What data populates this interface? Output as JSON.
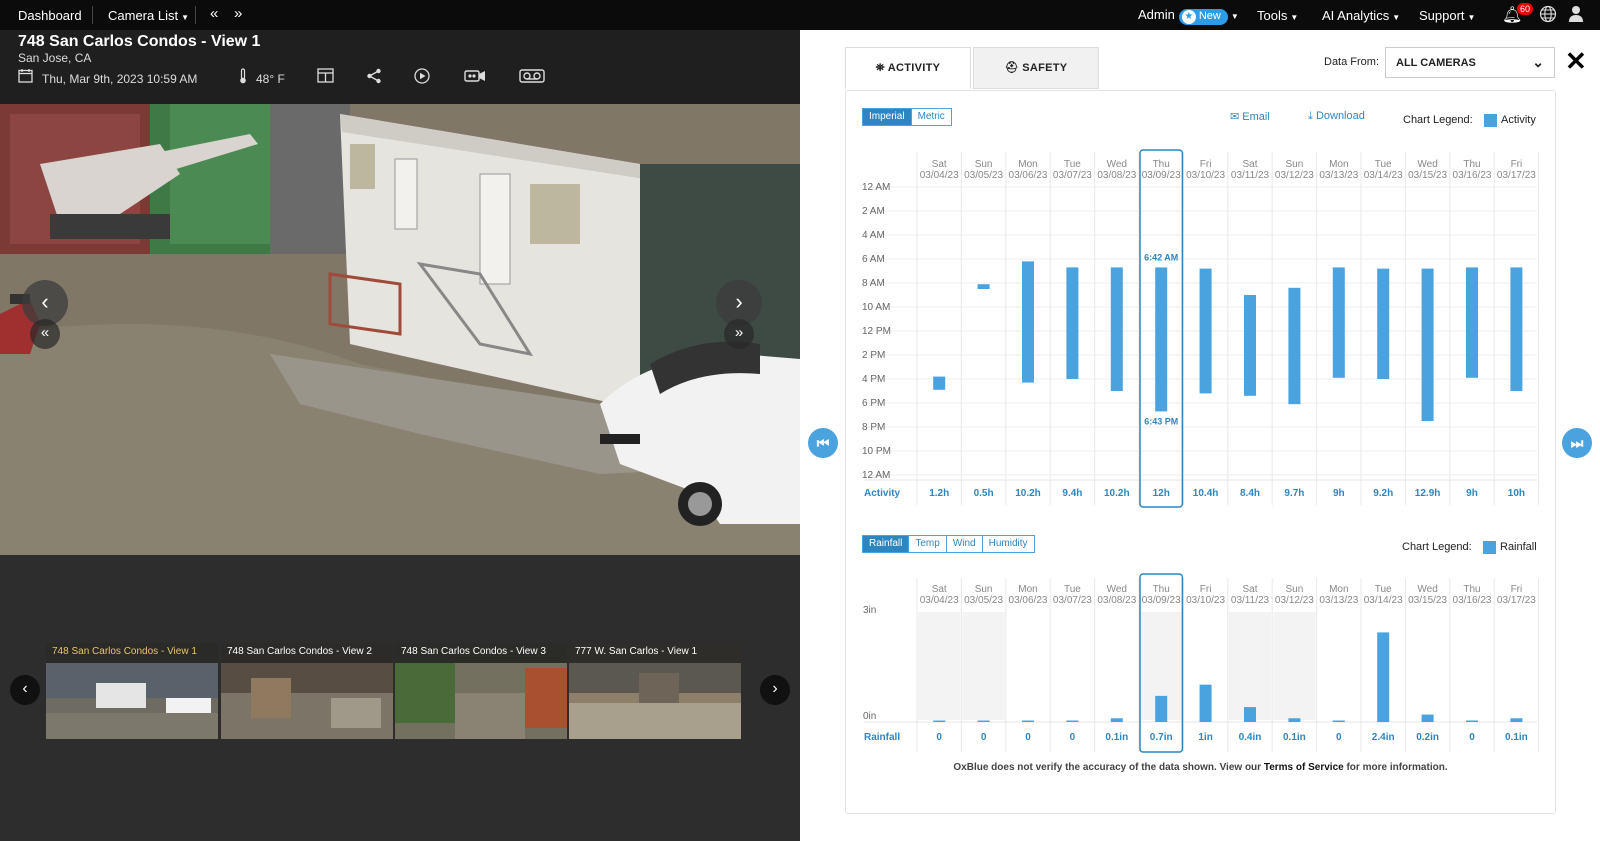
{
  "topbar": {
    "dashboard": "Dashboard",
    "camera_list": "Camera List",
    "admin": "Admin",
    "new_badge": "New",
    "tools": "Tools",
    "ai_analytics": "AI Analytics",
    "support": "Support",
    "notification_count": "60"
  },
  "camera": {
    "title": "748 San Carlos Condos - View 1",
    "location": "San Jose, CA",
    "datetime": "Thu, Mar 9th, 2023 10:59 AM",
    "temperature": "48° F"
  },
  "thumbnails": [
    {
      "label": "748 San Carlos Condos - View 1",
      "active": true
    },
    {
      "label": "748 San Carlos Condos - View 2",
      "active": false
    },
    {
      "label": "748 San Carlos Condos - View 3",
      "active": false
    },
    {
      "label": "777 W. San Carlos - View 1",
      "active": false
    }
  ],
  "tabs": {
    "activity": "ACTIVITY",
    "safety": "SAFETY"
  },
  "data_from": {
    "label": "Data From:",
    "value": "ALL CAMERAS"
  },
  "units": {
    "imperial": "Imperial",
    "metric": "Metric"
  },
  "actions": {
    "email": "Email",
    "download": "Download"
  },
  "legend": {
    "label": "Chart Legend:",
    "activity": "Activity",
    "rainfall": "Rainfall"
  },
  "weather_tabs": {
    "rainfall": "Rainfall",
    "temp": "Temp",
    "wind": "Wind",
    "humidity": "Humidity"
  },
  "disclaimer": {
    "prefix": "OxBlue does not verify the accuracy of the data shown. View our ",
    "link": "Terms of Service",
    "suffix": " for more information."
  },
  "colors": {
    "accent": "#4aa3df",
    "accent_dark": "#2e86c1",
    "highlight_border": "#2e86c1"
  },
  "chart_data": [
    {
      "type": "bar",
      "name": "activity",
      "days": [
        {
          "dow": "Sat",
          "date": "03/04/23"
        },
        {
          "dow": "Sun",
          "date": "03/05/23"
        },
        {
          "dow": "Mon",
          "date": "03/06/23"
        },
        {
          "dow": "Tue",
          "date": "03/07/23"
        },
        {
          "dow": "Wed",
          "date": "03/08/23"
        },
        {
          "dow": "Thu",
          "date": "03/09/23"
        },
        {
          "dow": "Fri",
          "date": "03/10/23"
        },
        {
          "dow": "Sat",
          "date": "03/11/23"
        },
        {
          "dow": "Sun",
          "date": "03/12/23"
        },
        {
          "dow": "Mon",
          "date": "03/13/23"
        },
        {
          "dow": "Tue",
          "date": "03/14/23"
        },
        {
          "dow": "Wed",
          "date": "03/15/23"
        },
        {
          "dow": "Thu",
          "date": "03/16/23"
        },
        {
          "dow": "Fri",
          "date": "03/17/23"
        }
      ],
      "y_ticks": [
        "12 AM",
        "2 AM",
        "4 AM",
        "6 AM",
        "8 AM",
        "10 AM",
        "12 PM",
        "2 PM",
        "4 PM",
        "6 PM",
        "8 PM",
        "10 PM",
        "12 AM"
      ],
      "ylim_hours": [
        0,
        24
      ],
      "ranges_hours": [
        [
          15.8,
          16.9
        ],
        [
          8.1,
          8.5
        ],
        [
          6.2,
          16.3
        ],
        [
          6.7,
          16.0
        ],
        [
          6.7,
          17.0
        ],
        [
          6.7,
          18.7
        ],
        [
          6.8,
          17.2
        ],
        [
          9.0,
          17.4
        ],
        [
          8.4,
          18.1
        ],
        [
          6.7,
          15.9
        ],
        [
          6.8,
          16.0
        ],
        [
          6.8,
          19.5
        ],
        [
          6.7,
          15.9
        ],
        [
          6.7,
          17.0
        ]
      ],
      "row_label": "Activity",
      "totals": [
        "1.2h",
        "0.5h",
        "10.2h",
        "9.4h",
        "10.2h",
        "12h",
        "10.4h",
        "8.4h",
        "9.7h",
        "9h",
        "9.2h",
        "12.9h",
        "9h",
        "10h"
      ],
      "highlight_index": 5,
      "highlight_start": "6:42 AM",
      "highlight_end": "6:43 PM"
    },
    {
      "type": "bar",
      "name": "rainfall",
      "y_ticks": [
        "3in",
        "0in"
      ],
      "ylim": [
        0,
        3
      ],
      "values": [
        0.03,
        0.03,
        0.02,
        0,
        0.1,
        0.7,
        1.0,
        0.4,
        0.1,
        0,
        2.4,
        0.2,
        0,
        0.1
      ],
      "row_label": "Rainfall",
      "labels": [
        "0",
        "0",
        "0",
        "0",
        "0.1in",
        "0.7in",
        "1in",
        "0.4in",
        "0.1in",
        "0",
        "2.4in",
        "0.2in",
        "0",
        "0.1in"
      ],
      "highlight_index": 5,
      "shaded_indices": [
        0,
        1,
        5,
        7,
        8
      ]
    }
  ]
}
